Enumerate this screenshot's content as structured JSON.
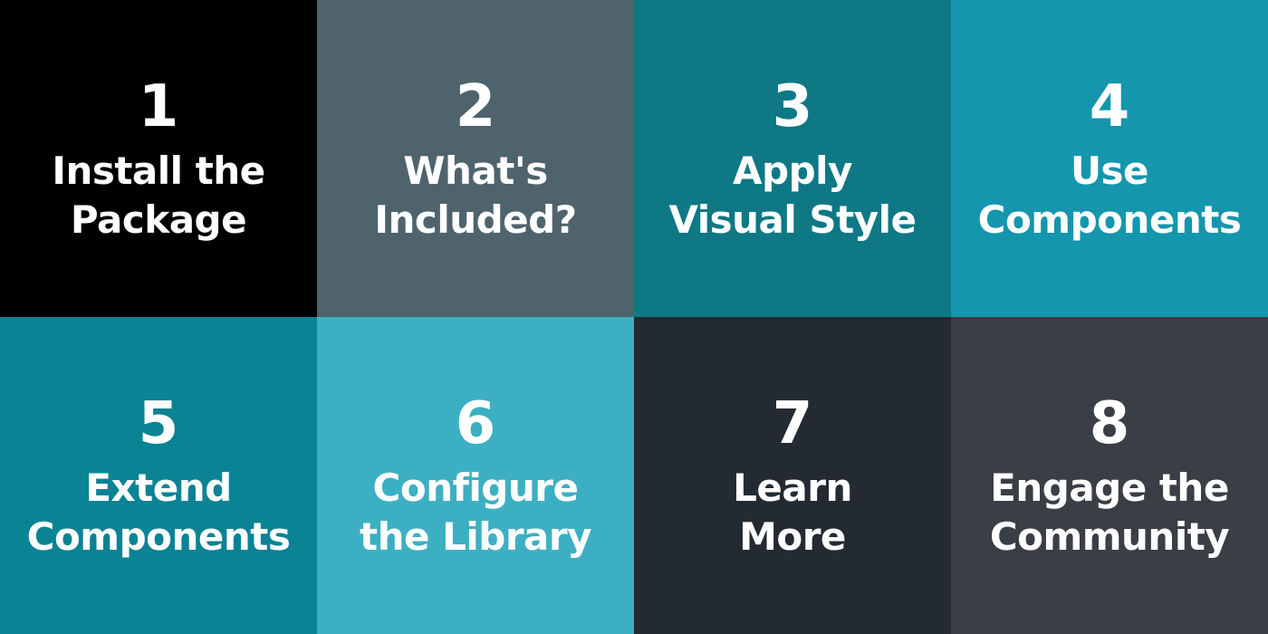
{
  "tiles": [
    {
      "number": "1",
      "lines": [
        "Install the",
        "Package"
      ],
      "color": "#000000"
    },
    {
      "number": "2",
      "lines": [
        "What's",
        "Included?"
      ],
      "color": "#4f636d"
    },
    {
      "number": "3",
      "lines": [
        "Apply",
        "Visual Style"
      ],
      "color": "#0e7885"
    },
    {
      "number": "4",
      "lines": [
        "Use",
        "Components"
      ],
      "color": "#1496ad"
    },
    {
      "number": "5",
      "lines": [
        "Extend",
        "Components"
      ],
      "color": "#0a8394"
    },
    {
      "number": "6",
      "lines": [
        "Configure",
        "the Library"
      ],
      "color": "#3cb0c2"
    },
    {
      "number": "7",
      "lines": [
        "Learn",
        "More"
      ],
      "color": "#242a31"
    },
    {
      "number": "8",
      "lines": [
        "Engage the",
        "Community"
      ],
      "color": "#3a3e45"
    }
  ]
}
